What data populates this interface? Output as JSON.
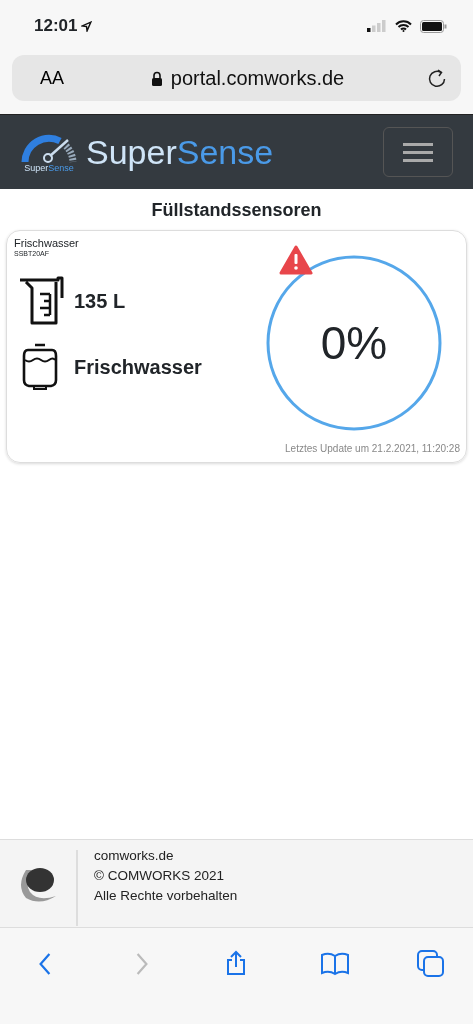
{
  "status_bar": {
    "time": "12:01"
  },
  "address_bar": {
    "text_size": "AA",
    "url": "portal.comworks.de"
  },
  "navbar": {
    "brand_first": "Super",
    "brand_second": "Sense",
    "badge_first": "Super",
    "badge_second": "Sense"
  },
  "page_title": "Füllstandssensoren",
  "sensors": [
    {
      "name": "Frischwasser",
      "id": "SSBT20AF",
      "volume": "135 L",
      "tank": "Frischwasser",
      "percent": "0%",
      "alert": true,
      "updated": "Letztes Update um 21.2.2021, 11:20:28"
    }
  ],
  "footer": {
    "lines": [
      "comworks.de",
      "© COMWORKS 2021",
      "Alle Rechte vorbehalten"
    ]
  },
  "toolbar": [
    {
      "kind": "back",
      "disabled": false
    },
    {
      "kind": "forward",
      "disabled": true
    },
    {
      "kind": "share",
      "disabled": false
    },
    {
      "kind": "bookmarks",
      "disabled": false
    },
    {
      "kind": "tabs",
      "disabled": false
    }
  ]
}
